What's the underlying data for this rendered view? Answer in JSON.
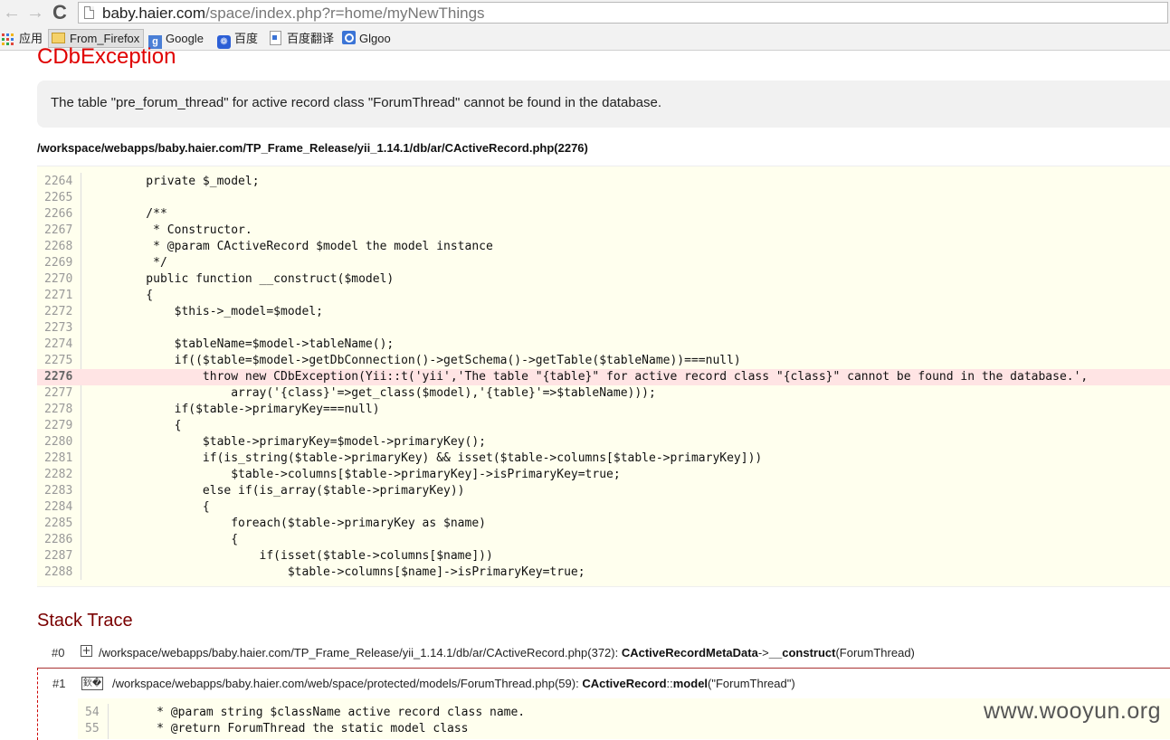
{
  "browser": {
    "url_host": "baby.haier.com",
    "url_path": "/space/index.php?r=home/myNewThings",
    "back_glyph": "←",
    "forward_glyph": "→",
    "reload_glyph": "C",
    "bookmarks": [
      {
        "label": "应用",
        "icon": "apps-grid-icon"
      },
      {
        "label": "From_Firefox",
        "icon": "folder-icon"
      },
      {
        "label": "Google",
        "icon": "google-icon"
      },
      {
        "label": "百度",
        "icon": "baidu-paw-icon"
      },
      {
        "label": "百度翻译",
        "icon": "baidu-translate-icon"
      },
      {
        "label": "Glgoo",
        "icon": "glgoo-search-icon"
      }
    ]
  },
  "exception": {
    "title": "CDbException",
    "message": "The table \"pre_forum_thread\" for active record class \"ForumThread\" cannot be found in the database.",
    "source_path": "/workspace/webapps/baby.haier.com/TP_Frame_Release/yii_1.14.1/db/ar/CActiveRecord.php(2276)",
    "error_line": "2276",
    "code": [
      {
        "n": "2264",
        "code": "    private $_model;"
      },
      {
        "n": "2265",
        "code": ""
      },
      {
        "n": "2266",
        "code": "    /**"
      },
      {
        "n": "2267",
        "code": "     * Constructor."
      },
      {
        "n": "2268",
        "code": "     * @param CActiveRecord $model the model instance"
      },
      {
        "n": "2269",
        "code": "     */"
      },
      {
        "n": "2270",
        "code": "    public function __construct($model)"
      },
      {
        "n": "2271",
        "code": "    {"
      },
      {
        "n": "2272",
        "code": "        $this->_model=$model;"
      },
      {
        "n": "2273",
        "code": ""
      },
      {
        "n": "2274",
        "code": "        $tableName=$model->tableName();"
      },
      {
        "n": "2275",
        "code": "        if(($table=$model->getDbConnection()->getSchema()->getTable($tableName))===null)"
      },
      {
        "n": "2276",
        "code": "            throw new CDbException(Yii::t('yii','The table \"{table}\" for active record class \"{class}\" cannot be found in the database.',"
      },
      {
        "n": "2277",
        "code": "                array('{class}'=>get_class($model),'{table}'=>$tableName)));"
      },
      {
        "n": "2278",
        "code": "        if($table->primaryKey===null)"
      },
      {
        "n": "2279",
        "code": "        {"
      },
      {
        "n": "2280",
        "code": "            $table->primaryKey=$model->primaryKey();"
      },
      {
        "n": "2281",
        "code": "            if(is_string($table->primaryKey) && isset($table->columns[$table->primaryKey]))"
      },
      {
        "n": "2282",
        "code": "                $table->columns[$table->primaryKey]->isPrimaryKey=true;"
      },
      {
        "n": "2283",
        "code": "            else if(is_array($table->primaryKey))"
      },
      {
        "n": "2284",
        "code": "            {"
      },
      {
        "n": "2285",
        "code": "                foreach($table->primaryKey as $name)"
      },
      {
        "n": "2286",
        "code": "                {"
      },
      {
        "n": "2287",
        "code": "                    if(isset($table->columns[$name]))"
      },
      {
        "n": "2288",
        "code": "                        $table->columns[$name]->isPrimaryKey=true;"
      }
    ]
  },
  "stack": {
    "title": "Stack Trace",
    "frames": [
      {
        "num": "#0",
        "toggle": "+",
        "path": "/workspace/webapps/baby.haier.com/TP_Frame_Release/yii_1.14.1/db/ar/CActiveRecord.php(372): ",
        "cls": "CActiveRecordMetaData",
        "op": "->",
        "method": "__construct",
        "args": "(ForumThread)"
      },
      {
        "num": "#1",
        "toggle": "鈥�",
        "path": "/workspace/webapps/baby.haier.com/web/space/protected/models/ForumThread.php(59): ",
        "cls": "CActiveRecord",
        "op": "::",
        "method": "model",
        "args": "(\"ForumThread\")",
        "code": [
          {
            "n": "54",
            "code": "     * @param string $className active record class name."
          },
          {
            "n": "55",
            "code": "     * @return ForumThread the static model class"
          }
        ]
      }
    ]
  },
  "watermark": "www.wooyun.org",
  "colors": {
    "exception_title": "#e00000",
    "stack_title": "#7a0000",
    "error_line_bg": "#ffe4e4",
    "code_bg": "#ffffee"
  }
}
